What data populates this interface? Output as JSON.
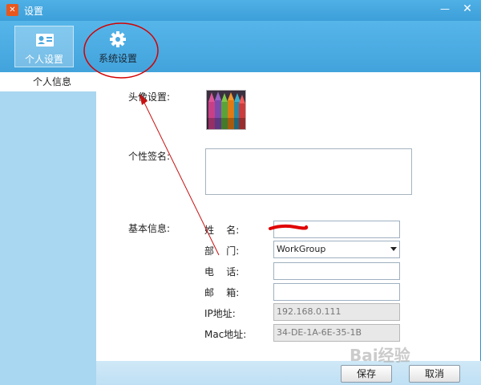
{
  "window": {
    "title": "设置",
    "minimize_icon": "minimize-icon",
    "close_icon": "close-icon"
  },
  "toolbar": {
    "tabs": [
      {
        "label": "个人设置",
        "icon": "id-card-icon",
        "active": true
      },
      {
        "label": "系统设置",
        "icon": "gear-icon",
        "active": false
      }
    ]
  },
  "sidebar": {
    "items": [
      {
        "label": "个人信息",
        "selected": true
      }
    ]
  },
  "form": {
    "avatar_label": "头像设置:",
    "signature_label": "个性签名:",
    "signature_value": "",
    "basic_info_label": "基本信息:",
    "fields": [
      {
        "label": "姓    名:",
        "value": "",
        "readonly": false
      },
      {
        "label": "部    门:",
        "value": "WorkGroup",
        "readonly": false,
        "type": "select"
      },
      {
        "label": "电    话:",
        "value": "",
        "readonly": false
      },
      {
        "label": "邮    箱:",
        "value": "",
        "readonly": false
      },
      {
        "label": "IP地址:",
        "value": "192.168.0.111",
        "readonly": true
      },
      {
        "label": "Mac地址:",
        "value": "34-DE-1A-6E-35-1B",
        "readonly": true
      }
    ]
  },
  "footer": {
    "save_label": "保存",
    "cancel_label": "取消"
  },
  "watermark": {
    "text": "Bai经验"
  },
  "colors": {
    "titlebar": "#4fb0e6",
    "sidebar": "#a9d6f0",
    "annotation": "#d40000"
  }
}
